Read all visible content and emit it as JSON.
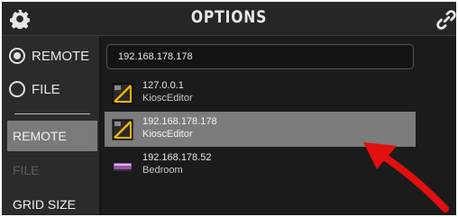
{
  "header": {
    "title": "OPTIONS",
    "settings_icon": "gear-icon",
    "link_icon": "link-icon"
  },
  "sidebar": {
    "mode_options": [
      {
        "label": "REMOTE",
        "selected": true
      },
      {
        "label": "FILE",
        "selected": false
      }
    ],
    "buttons": [
      {
        "label": "REMOTE",
        "state": "active"
      },
      {
        "label": "FILE",
        "state": "disabled"
      },
      {
        "label": "GRID SIZE",
        "state": "normal"
      }
    ]
  },
  "main": {
    "address_input": {
      "value": "192.168.178.178"
    },
    "hosts": [
      {
        "ip": "127.0.0.1",
        "name": "KioscEditor",
        "icon": "kiosc-editor-icon",
        "selected": false
      },
      {
        "ip": "192.168.178.178",
        "name": "KioscEditor",
        "icon": "kiosc-editor-icon",
        "selected": true
      },
      {
        "ip": "192.168.178.52",
        "name": "Bedroom",
        "icon": "device-icon",
        "selected": false
      }
    ]
  },
  "colors": {
    "selection": "#7c7c7c",
    "annotation_arrow": "#e01010",
    "background": "#1b1b1b"
  }
}
